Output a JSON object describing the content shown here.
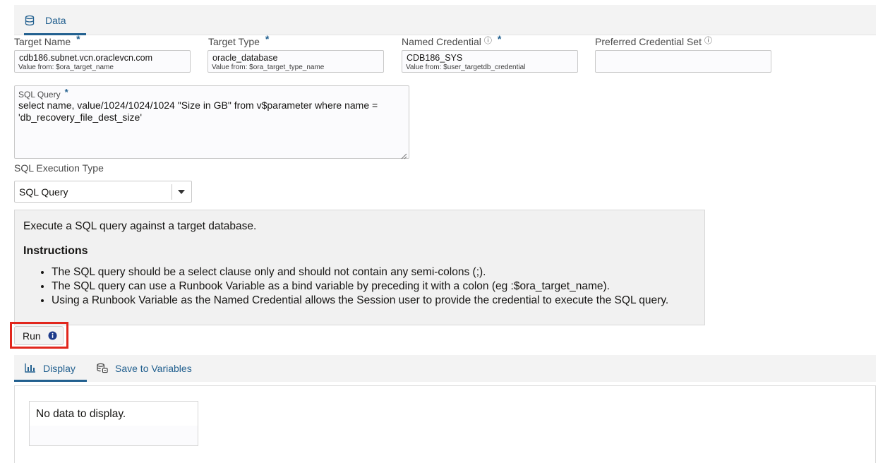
{
  "top_tabs": [
    {
      "label": "Data",
      "icon": "database-icon"
    }
  ],
  "fields": {
    "target_name": {
      "label": "Target Name",
      "required": "*",
      "value": "cdb186.subnet.vcn.oraclevcn.com",
      "hint": "Value from: $ora_target_name"
    },
    "target_type": {
      "label": "Target Type",
      "required": "*",
      "value": "oracle_database",
      "hint": "Value from: $ora_target_type_name"
    },
    "named_credential": {
      "label": "Named Credential",
      "info": "ⓘ",
      "required": "*",
      "value": "CDB186_SYS",
      "hint": "Value from: $user_targetdb_credential"
    },
    "preferred_credential_set": {
      "label": "Preferred Credential Set",
      "info": "ⓘ",
      "value": ""
    }
  },
  "sql_query": {
    "label": "SQL Query",
    "required": "*",
    "value": "select name, value/1024/1024/1024 \"Size in GB\" from v$parameter where name =\n'db_recovery_file_dest_size'"
  },
  "sql_execution_type": {
    "label": "SQL Execution Type",
    "selected": "SQL Query"
  },
  "info_panel": {
    "description": "Execute a SQL query against a target database.",
    "heading": "Instructions",
    "items": [
      "The SQL query should be a select clause only and should not contain any semi-colons (;).",
      "The SQL query can use a Runbook Variable as a bind variable by preceding it with a colon (eg :$ora_target_name).",
      "Using a Runbook Variable as the Named Credential allows the Session user to provide the credential to execute the SQL query."
    ]
  },
  "run_button": {
    "label": "Run",
    "highlight_color": "#e1261c"
  },
  "result_tabs": [
    {
      "label": "Display",
      "icon": "chart-icon"
    },
    {
      "label": "Save to Variables",
      "icon": "save-variables-icon"
    }
  ],
  "results": {
    "empty_message": "No data to display."
  },
  "colors": {
    "accent": "#22608f",
    "highlight": "#e1261c",
    "panel_bg": "#f1f1f1"
  }
}
